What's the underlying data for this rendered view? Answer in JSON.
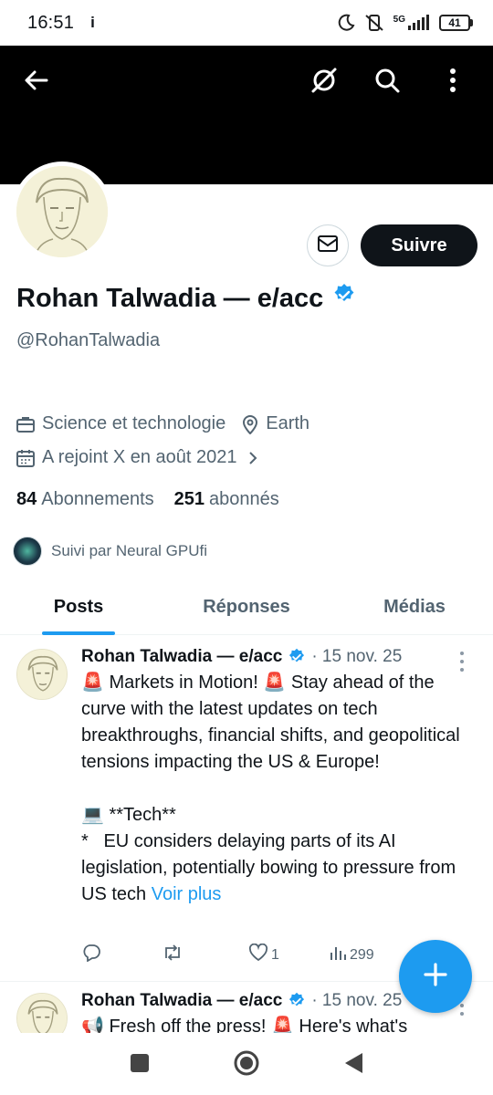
{
  "status_bar": {
    "time": "16:51",
    "info_glyph": "i",
    "network": "5G",
    "battery": "41"
  },
  "header": {
    "back_icon": "arrow-left-icon",
    "grok_icon": "grok-icon",
    "search_icon": "search-icon",
    "more_icon": "more-vertical-icon"
  },
  "profile": {
    "display_name": "Rohan Talwadia — e/acc",
    "handle": "@RohanTalwadia",
    "follow_label": "Suivre",
    "category": "Science et technologie",
    "location": "Earth",
    "joined": "A rejoint X en août 2021",
    "following_count": "84",
    "following_label": "Abonnements",
    "followers_count": "251",
    "followers_label": "abonnés",
    "followed_by": "Suivi par Neural GPUfi"
  },
  "tabs": [
    {
      "label": "Posts",
      "active": true
    },
    {
      "label": "Réponses",
      "active": false
    },
    {
      "label": "Médias",
      "active": false
    }
  ],
  "posts": [
    {
      "author": "Rohan Talwadia — e/acc",
      "date": "· 15 nov. 25",
      "line1_a": " Markets in Motion! ",
      "line1_b": " Stay ahead of the curve with the latest updates on tech breakthroughs, financial shifts, and geopolitical tensions impacting the US & Europe!",
      "tech_header": " **Tech**",
      "tech_item": "*   EU considers delaying parts of its AI legislation, potentially bowing to pressure from US tech ",
      "see_more": "Voir plus",
      "replies": "",
      "reposts": "",
      "likes": "1",
      "views": "299"
    },
    {
      "author": "Rohan Talwadia — e/acc",
      "date": "· 15 nov. 25",
      "text_a": " Fresh off the press! ",
      "text_b": " Here's what's"
    }
  ],
  "colors": {
    "accent": "#1d9bf0",
    "text": "#0f1419",
    "muted": "#536471",
    "banner": "#000000"
  }
}
